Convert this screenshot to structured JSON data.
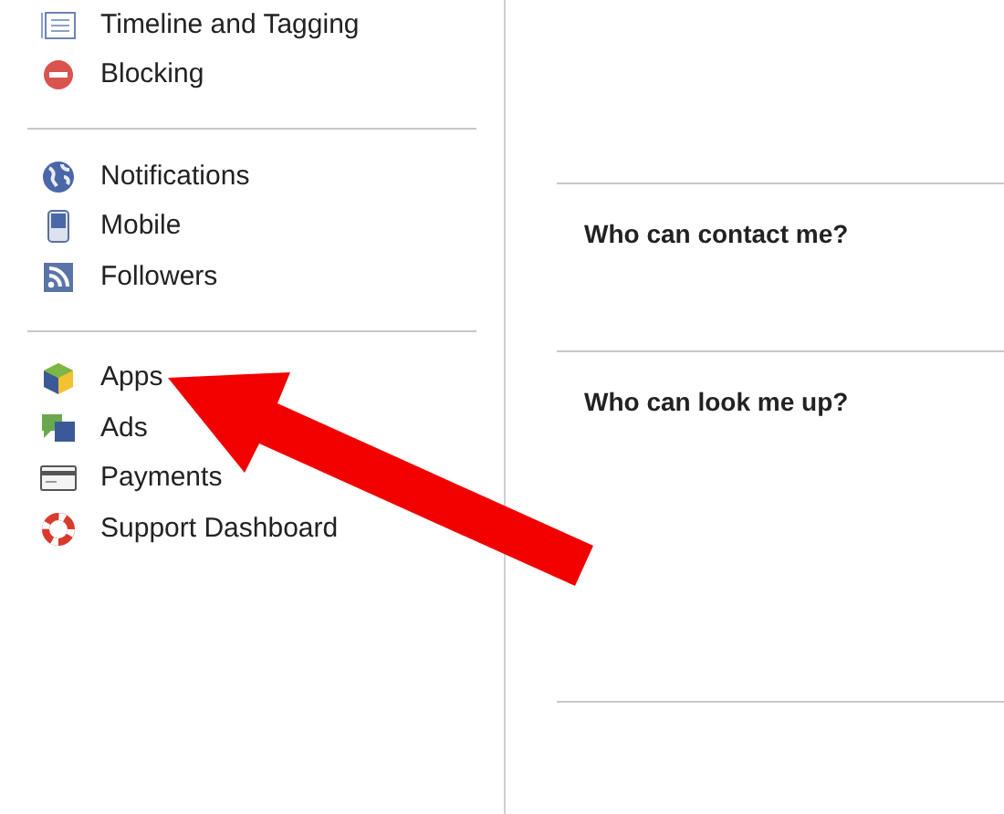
{
  "sidebar": {
    "groups": [
      {
        "items": [
          {
            "label": "Timeline and Tagging"
          },
          {
            "label": "Blocking"
          }
        ]
      },
      {
        "items": [
          {
            "label": "Notifications"
          },
          {
            "label": "Mobile"
          },
          {
            "label": "Followers"
          }
        ]
      },
      {
        "items": [
          {
            "label": "Apps"
          },
          {
            "label": "Ads"
          },
          {
            "label": "Payments"
          },
          {
            "label": "Support Dashboard"
          }
        ]
      }
    ]
  },
  "sections": [
    {
      "heading": "Who can contact me?"
    },
    {
      "heading": "Who can look me up?"
    }
  ]
}
